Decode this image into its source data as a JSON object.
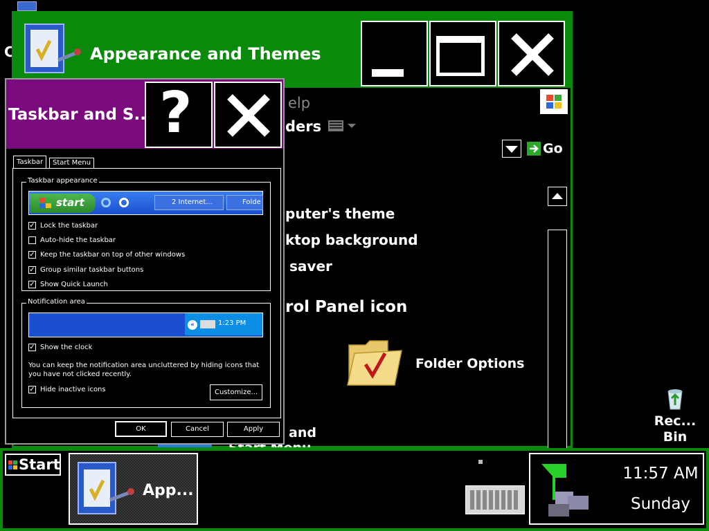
{
  "desktop": {
    "recycle_bin_label": "Rec... Bin",
    "left_edge_fragment": "C"
  },
  "appearance_window": {
    "title": "Appearance and Themes",
    "menu_fragment_help": "elp",
    "toolbar_fragment_folders": "ders",
    "go_label": "Go",
    "task_fragments": [
      "puter's theme",
      "ktop background",
      "saver"
    ],
    "control_panel_icon_fragment": "rol Panel icon",
    "folder_options_label": "Folder Options",
    "bottom_fragment": "and",
    "bottom_fragment_2": "Start Menu"
  },
  "dialog": {
    "title": "Taskbar and S...",
    "tabs": [
      "Taskbar",
      "Start Menu"
    ],
    "taskbar_appearance_legend": "Taskbar appearance",
    "preview_start": "start",
    "preview_item_1": "2 Internet...",
    "preview_item_2": "Folde",
    "options": [
      {
        "label": "Lock the taskbar",
        "checked": true
      },
      {
        "label": "Auto-hide the taskbar",
        "checked": false
      },
      {
        "label": "Keep the taskbar on top of other windows",
        "checked": true
      },
      {
        "label": "Group similar taskbar buttons",
        "checked": true
      },
      {
        "label": "Show Quick Launch",
        "checked": true
      }
    ],
    "notification_legend": "Notification area",
    "preview_time": "1:23 PM",
    "show_clock": "Show the clock",
    "note": "You can keep the notification area uncluttered by hiding icons that you have not clicked recently.",
    "hide_inactive": "Hide inactive icons",
    "customize_label": "Customize...",
    "ok_label": "OK",
    "cancel_label": "Cancel",
    "apply_label": "Apply"
  },
  "taskbar": {
    "start_label": "Start",
    "app_label": "App...",
    "time": "11:57 AM",
    "day": "Sunday"
  },
  "colors": {
    "appearance_title": "#0a8a0a",
    "dialog_title": "#7a0a7e",
    "taskbar_border": "#0a8a0a"
  }
}
